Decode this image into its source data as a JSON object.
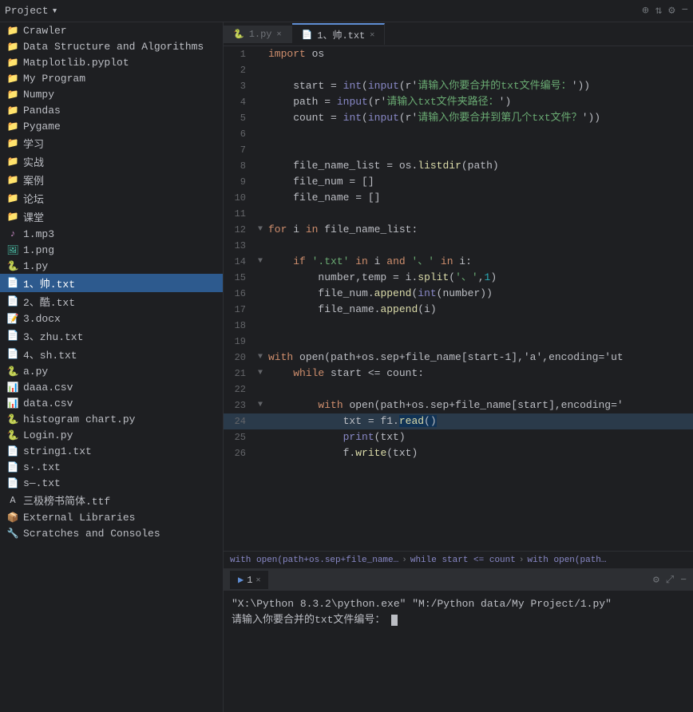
{
  "topbar": {
    "project_label": "Project",
    "chevron": "▾",
    "icons": [
      "+",
      "⇅",
      "⚙",
      "−"
    ]
  },
  "sidebar": {
    "items": [
      {
        "id": "crawler",
        "label": "Crawler",
        "type": "folder",
        "indent": 0
      },
      {
        "id": "dsa",
        "label": "Data Structure and Algorithms",
        "type": "folder",
        "indent": 0
      },
      {
        "id": "matplotlib",
        "label": "Matplotlib.pyplot",
        "type": "folder",
        "indent": 0
      },
      {
        "id": "myprogram",
        "label": "My Program",
        "type": "folder",
        "indent": 0
      },
      {
        "id": "numpy",
        "label": "Numpy",
        "type": "folder",
        "indent": 0
      },
      {
        "id": "pandas",
        "label": "Pandas",
        "type": "folder",
        "indent": 0
      },
      {
        "id": "pygame",
        "label": "Pygame",
        "type": "folder",
        "indent": 0
      },
      {
        "id": "study",
        "label": "学习",
        "type": "folder",
        "indent": 0
      },
      {
        "id": "practice",
        "label": "实战",
        "type": "folder",
        "indent": 0
      },
      {
        "id": "cases",
        "label": "案例",
        "type": "folder",
        "indent": 0
      },
      {
        "id": "forum",
        "label": "论坛",
        "type": "folder",
        "indent": 0
      },
      {
        "id": "classroom",
        "label": "课堂",
        "type": "folder",
        "indent": 0
      },
      {
        "id": "mp3",
        "label": "1.mp3",
        "type": "mp3",
        "indent": 0
      },
      {
        "id": "png",
        "label": "1.png",
        "type": "png",
        "indent": 0
      },
      {
        "id": "py1",
        "label": "1.py",
        "type": "py",
        "indent": 0
      },
      {
        "id": "txt1",
        "label": "1、帅.txt",
        "type": "txt",
        "indent": 0,
        "active": true
      },
      {
        "id": "txt2",
        "label": "2、酷.txt",
        "type": "txt",
        "indent": 0
      },
      {
        "id": "docx3",
        "label": "3.docx",
        "type": "docx",
        "indent": 0
      },
      {
        "id": "txt3zh",
        "label": "3、zhu.txt",
        "type": "txt",
        "indent": 0
      },
      {
        "id": "txt4sh",
        "label": "4、sh.txt",
        "type": "txt",
        "indent": 0
      },
      {
        "id": "apy",
        "label": "a.py",
        "type": "py",
        "indent": 0
      },
      {
        "id": "daaacsv",
        "label": "daaa.csv",
        "type": "csv",
        "indent": 0
      },
      {
        "id": "datacsv",
        "label": "data.csv",
        "type": "csv",
        "indent": 0
      },
      {
        "id": "histpy",
        "label": "histogram chart.py",
        "type": "py",
        "indent": 0
      },
      {
        "id": "loginpy",
        "label": "Login.py",
        "type": "py",
        "indent": 0
      },
      {
        "id": "string1txt",
        "label": "string1.txt",
        "type": "txt",
        "indent": 0
      },
      {
        "id": "sdottxt",
        "label": "s·.txt",
        "type": "txt",
        "indent": 0
      },
      {
        "id": "sdshtxt",
        "label": "s—.txt",
        "type": "txt",
        "indent": 0
      },
      {
        "id": "ttf",
        "label": "三极榜书简体.ttf",
        "type": "ttf",
        "indent": 0
      },
      {
        "id": "extlib",
        "label": "External Libraries",
        "type": "ext",
        "indent": 0
      },
      {
        "id": "scratches",
        "label": "Scratches and Consoles",
        "type": "ext",
        "indent": 0
      }
    ]
  },
  "tabs": [
    {
      "id": "tab1py",
      "label": "1.py",
      "type": "py",
      "active": false
    },
    {
      "id": "tab1txt",
      "label": "1、帅.txt",
      "type": "txt",
      "active": true
    }
  ],
  "code": {
    "lines": [
      {
        "num": 1,
        "fold": false,
        "tokens": [
          {
            "t": "import",
            "c": "kw"
          },
          {
            "t": " os",
            "c": "var"
          }
        ]
      },
      {
        "num": 2,
        "fold": false,
        "tokens": []
      },
      {
        "num": 3,
        "fold": false,
        "tokens": [
          {
            "t": "start",
            "c": "var"
          },
          {
            "t": " = ",
            "c": "op"
          },
          {
            "t": "int",
            "c": "builtin"
          },
          {
            "t": "(",
            "c": "paren"
          },
          {
            "t": "input",
            "c": "builtin"
          },
          {
            "t": "(r'",
            "c": "paren"
          },
          {
            "t": "请输入你要合并的txt文件编号：",
            "c": "str"
          },
          {
            "t": "'))",
            "c": "paren"
          }
        ]
      },
      {
        "num": 4,
        "fold": false,
        "tokens": [
          {
            "t": "path",
            "c": "var"
          },
          {
            "t": " = ",
            "c": "op"
          },
          {
            "t": "input",
            "c": "builtin"
          },
          {
            "t": "(r'",
            "c": "paren"
          },
          {
            "t": "请输入txt文件夹路径：",
            "c": "str"
          },
          {
            "t": "')",
            "c": "paren"
          }
        ]
      },
      {
        "num": 5,
        "fold": false,
        "tokens": [
          {
            "t": "count",
            "c": "var"
          },
          {
            "t": " = ",
            "c": "op"
          },
          {
            "t": "int",
            "c": "builtin"
          },
          {
            "t": "(",
            "c": "paren"
          },
          {
            "t": "input",
            "c": "builtin"
          },
          {
            "t": "(r'",
            "c": "paren"
          },
          {
            "t": "请输入你要合并到第几个txt文件？",
            "c": "str"
          },
          {
            "t": "'))",
            "c": "paren"
          }
        ]
      },
      {
        "num": 6,
        "fold": false,
        "tokens": []
      },
      {
        "num": 7,
        "fold": false,
        "tokens": []
      },
      {
        "num": 8,
        "fold": false,
        "tokens": [
          {
            "t": "file_name_list",
            "c": "var"
          },
          {
            "t": " = ",
            "c": "op"
          },
          {
            "t": "os",
            "c": "var"
          },
          {
            "t": ".",
            "c": "op"
          },
          {
            "t": "listdir",
            "c": "fn2"
          },
          {
            "t": "(path)",
            "c": "paren"
          }
        ]
      },
      {
        "num": 9,
        "fold": false,
        "tokens": [
          {
            "t": "file_num",
            "c": "var"
          },
          {
            "t": " = []",
            "c": "bracket"
          }
        ]
      },
      {
        "num": 10,
        "fold": false,
        "tokens": [
          {
            "t": "file_name",
            "c": "var"
          },
          {
            "t": " = []",
            "c": "bracket"
          }
        ]
      },
      {
        "num": 11,
        "fold": false,
        "tokens": []
      },
      {
        "num": 12,
        "fold": true,
        "tokens": [
          {
            "t": "for",
            "c": "kw"
          },
          {
            "t": " i ",
            "c": "var"
          },
          {
            "t": "in",
            "c": "kw"
          },
          {
            "t": " file_name_list:",
            "c": "var"
          }
        ]
      },
      {
        "num": 13,
        "fold": false,
        "tokens": []
      },
      {
        "num": 14,
        "fold": true,
        "tokens": [
          {
            "t": "    ",
            "c": "var"
          },
          {
            "t": "if",
            "c": "kw"
          },
          {
            "t": " '.txt' ",
            "c": "str"
          },
          {
            "t": "in",
            "c": "kw"
          },
          {
            "t": " i ",
            "c": "var"
          },
          {
            "t": "and",
            "c": "kw"
          },
          {
            "t": " '、' ",
            "c": "str"
          },
          {
            "t": "in",
            "c": "kw"
          },
          {
            "t": " i:",
            "c": "var"
          }
        ]
      },
      {
        "num": 15,
        "fold": false,
        "tokens": [
          {
            "t": "        number,temp",
            "c": "var"
          },
          {
            "t": " = ",
            "c": "op"
          },
          {
            "t": "i",
            "c": "var"
          },
          {
            "t": ".",
            "c": "op"
          },
          {
            "t": "split",
            "c": "fn2"
          },
          {
            "t": "('、',",
            "c": "str"
          },
          {
            "t": "1)",
            "c": "num"
          }
        ]
      },
      {
        "num": 16,
        "fold": false,
        "tokens": [
          {
            "t": "        file_num",
            "c": "var"
          },
          {
            "t": ".",
            "c": "op"
          },
          {
            "t": "append",
            "c": "fn2"
          },
          {
            "t": "(",
            "c": "paren"
          },
          {
            "t": "int",
            "c": "builtin"
          },
          {
            "t": "(number))",
            "c": "paren"
          }
        ]
      },
      {
        "num": 17,
        "fold": false,
        "tokens": [
          {
            "t": "        file_name",
            "c": "var"
          },
          {
            "t": ".",
            "c": "op"
          },
          {
            "t": "append",
            "c": "fn2"
          },
          {
            "t": "(i)",
            "c": "paren"
          }
        ]
      },
      {
        "num": 18,
        "fold": false,
        "tokens": []
      },
      {
        "num": 19,
        "fold": false,
        "tokens": []
      },
      {
        "num": 20,
        "fold": true,
        "tokens": [
          {
            "t": "with",
            "c": "kw"
          },
          {
            "t": " open(path+os.sep+file_name[start-1],'a',encoding='ut",
            "c": "var"
          }
        ]
      },
      {
        "num": 21,
        "fold": true,
        "tokens": [
          {
            "t": "    ",
            "c": "var"
          },
          {
            "t": "while",
            "c": "kw"
          },
          {
            "t": " start <= count:",
            "c": "var"
          }
        ]
      },
      {
        "num": 22,
        "fold": false,
        "tokens": []
      },
      {
        "num": 23,
        "fold": true,
        "tokens": [
          {
            "t": "        ",
            "c": "var"
          },
          {
            "t": "with",
            "c": "kw"
          },
          {
            "t": " open(path+os.sep+file_name[start],encoding='",
            "c": "var"
          }
        ]
      },
      {
        "num": 24,
        "fold": false,
        "tokens": [
          {
            "t": "            txt",
            "c": "var"
          },
          {
            "t": " = ",
            "c": "op"
          },
          {
            "t": "f1",
            "c": "var"
          },
          {
            "t": ".",
            "c": "op"
          },
          {
            "t": "read",
            "c": "fn2"
          },
          {
            "t": "()",
            "c": "paren"
          }
        ],
        "highlighted": true
      },
      {
        "num": 25,
        "fold": false,
        "tokens": [
          {
            "t": "            ",
            "c": "var"
          },
          {
            "t": "print",
            "c": "builtin"
          },
          {
            "t": "(txt)",
            "c": "paren"
          }
        ]
      },
      {
        "num": 26,
        "fold": false,
        "tokens": [
          {
            "t": "            f",
            "c": "var"
          },
          {
            "t": ".",
            "c": "op"
          },
          {
            "t": "write",
            "c": "fn2"
          },
          {
            "t": "(txt)",
            "c": "paren"
          }
        ]
      }
    ]
  },
  "breadcrumb": {
    "parts": [
      "with open(path+os.sep+file_name…",
      "while start <= count",
      "with open(path…"
    ]
  },
  "terminal": {
    "tab_label": "1",
    "cmd_line": "\"X:\\Python 8.3.2\\python.exe\" \"M:/Python data/My Project/1.py\"",
    "prompt_line": "请输入你要合并的txt文件编号："
  },
  "colors": {
    "bg": "#1e1f22",
    "sidebar_bg": "#1e1f22",
    "active_tab_bg": "#1e1f22",
    "inactive_tab_bg": "#2d2f33",
    "selected_item_bg": "#2d5a8e",
    "highlighted_line_bg": "#2a3a4a",
    "terminal_bg": "#1e1f22"
  }
}
